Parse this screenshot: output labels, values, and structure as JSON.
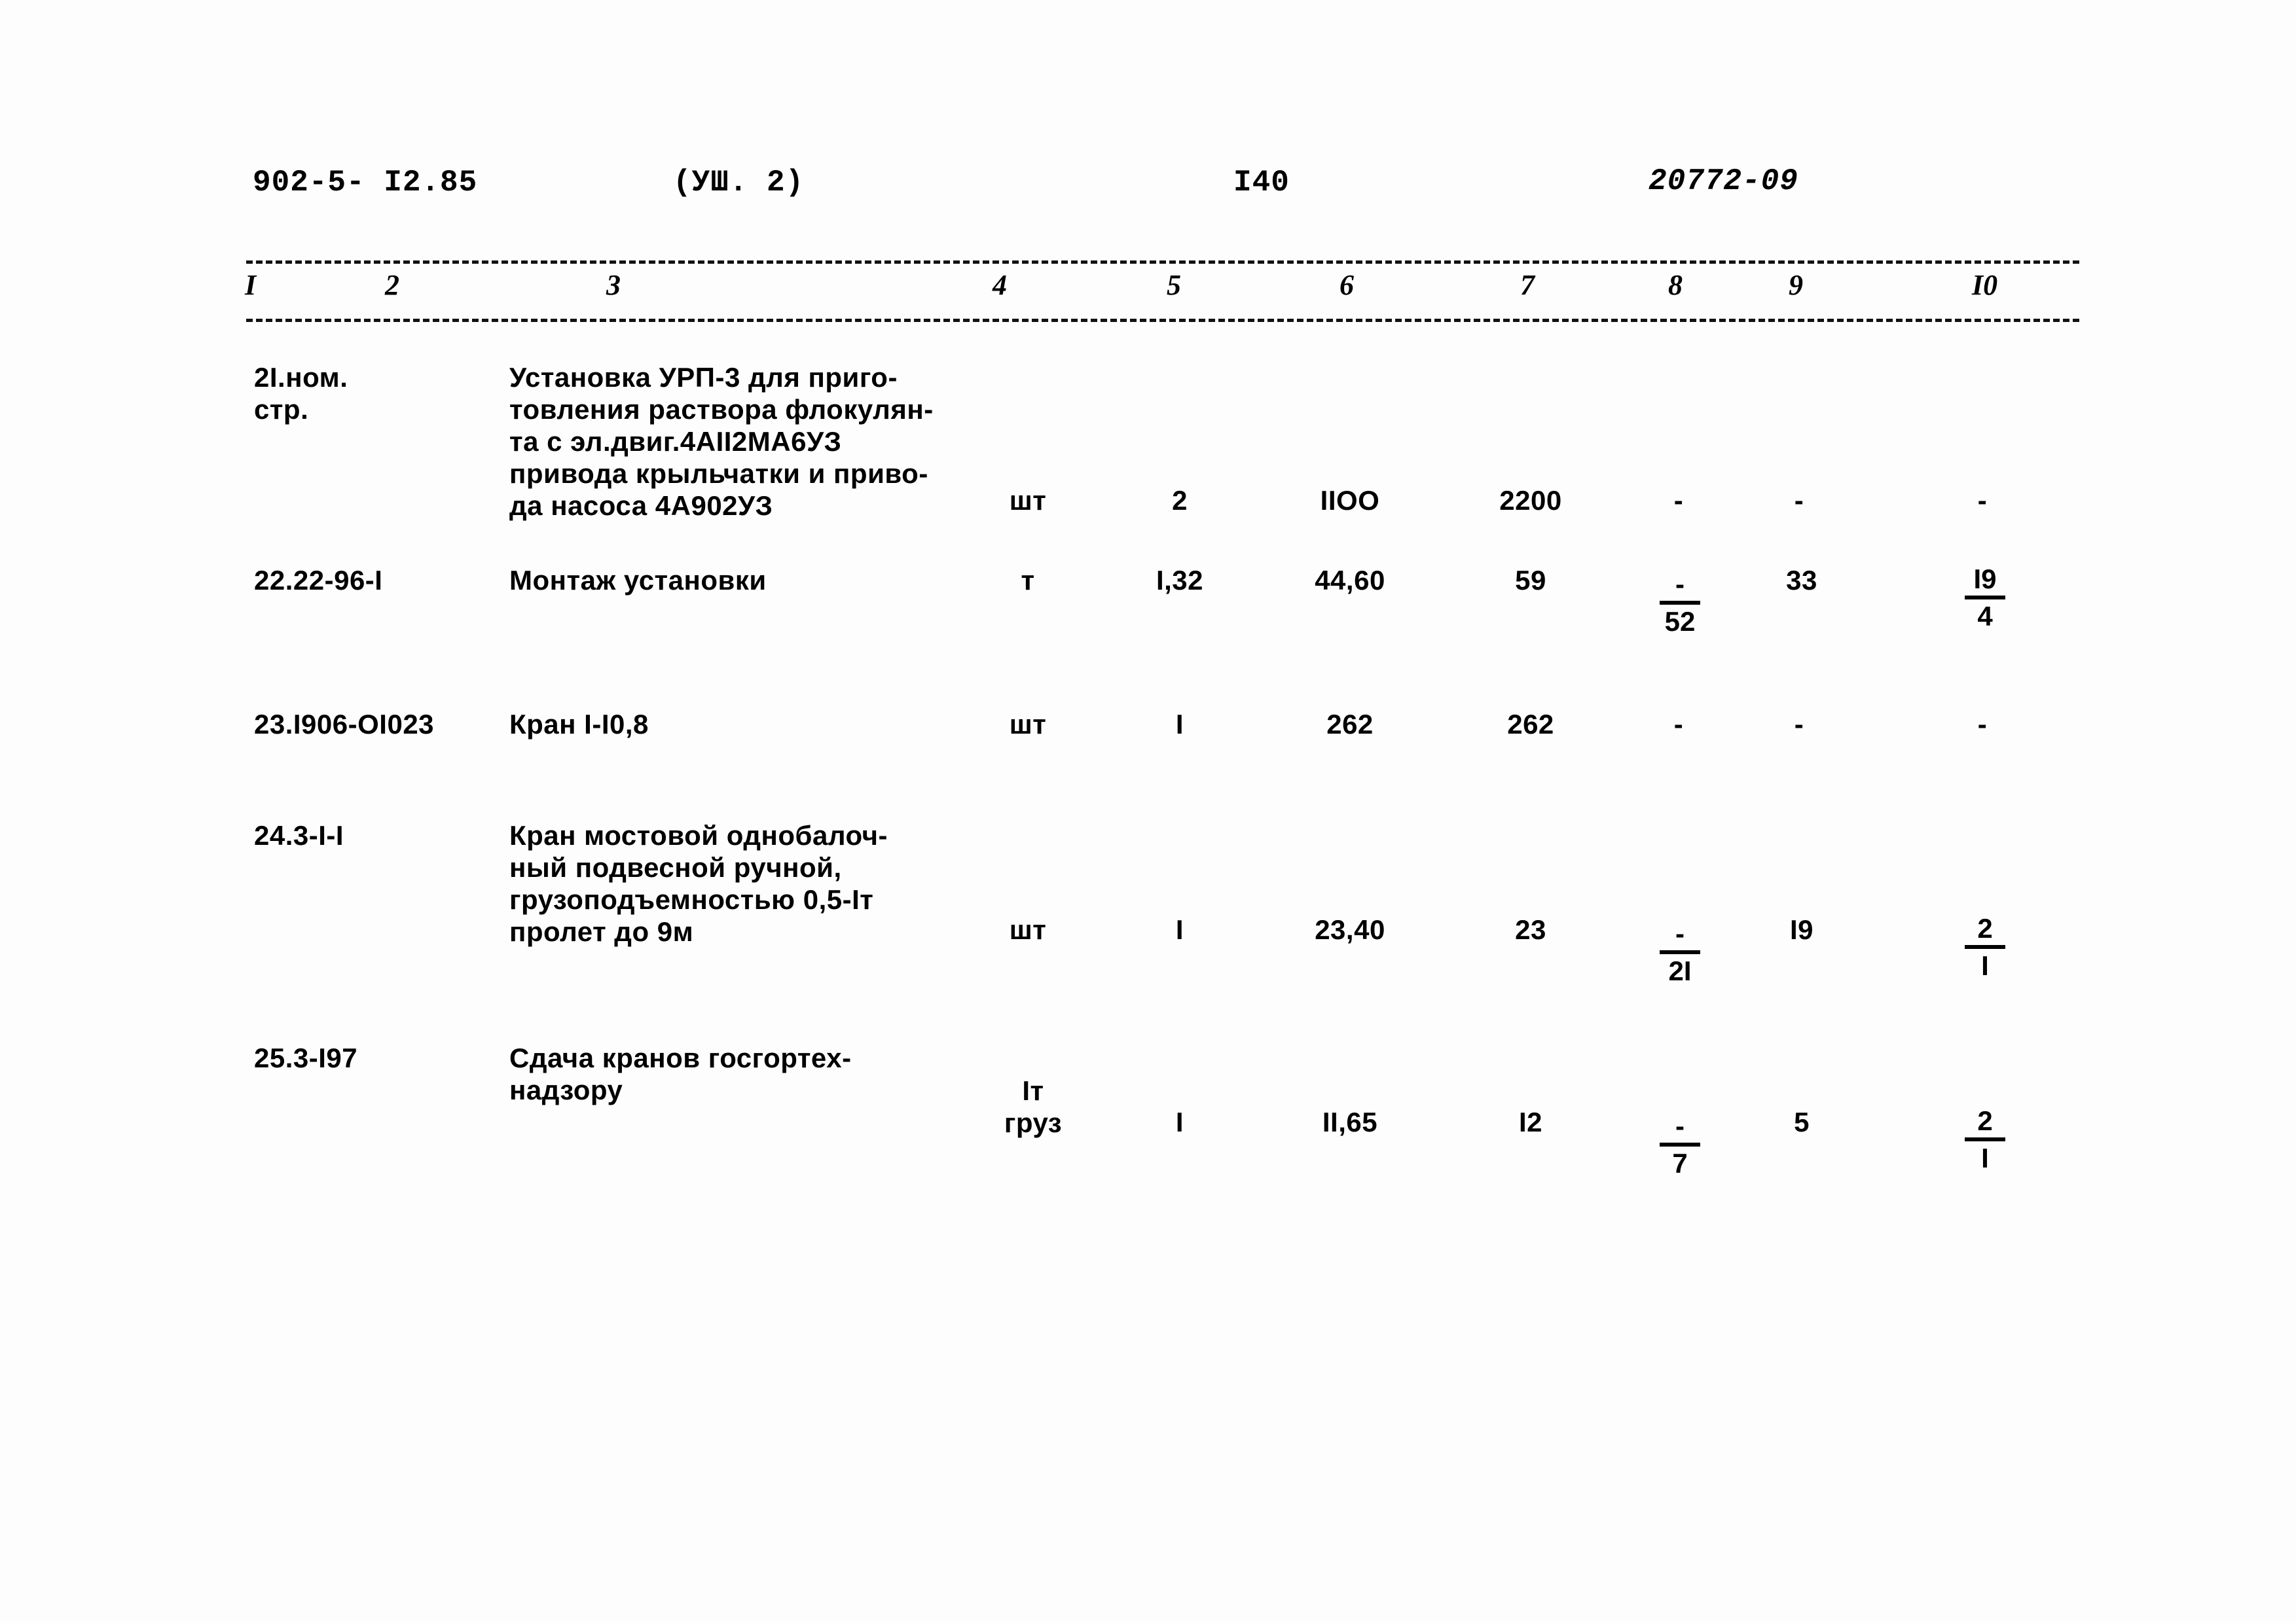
{
  "header": {
    "doc_code": "902-5- I2.85",
    "section": "(УШ. 2)",
    "page_number": "I40",
    "right_code": "20772-09"
  },
  "table": {
    "column_headers": [
      "I",
      "2",
      "3",
      "4",
      "5",
      "6",
      "7",
      "8",
      "9",
      "I0"
    ],
    "rows": [
      {
        "c1": "2I.ном.\n  стр.",
        "c3": "Установка УРП-3 для приго-\nтовления раствора флокулян-\nта с эл.двиг.4АII2МА6УЗ\nпривода крыльчатки и приво-\nда насоса 4А902УЗ",
        "c4": "шт",
        "c5": "2",
        "c6": "IIOO",
        "c7": "2200",
        "c8": "-",
        "c9": "-",
        "c10": "-"
      },
      {
        "c1": "22.22-96-I",
        "c3": "Монтаж установки",
        "c4": "т",
        "c5": "I,32",
        "c6": "44,60",
        "c7": "59",
        "c8_num": "-",
        "c8_den": "52",
        "c9": "33",
        "c10_num": "I9",
        "c10_den": "4"
      },
      {
        "c1": "23.I906-OI023",
        "c3": "Кран I-I0,8",
        "c4": "шт",
        "c5": "I",
        "c6": "262",
        "c7": "262",
        "c8": "-",
        "c9": "-",
        "c10": "-"
      },
      {
        "c1": "24.3-I-I",
        "c3": "Кран мостовой однобалоч-\nный подвесной ручной,\nгрузоподъемностью 0,5-Iт\nпролет до 9м",
        "c4": "шт",
        "c5": "I",
        "c6": "23,40",
        "c7": "23",
        "c8_num": "-",
        "c8_den": "2I",
        "c9": "I9",
        "c10_num": "2",
        "c10_den": "I"
      },
      {
        "c1": "25.3-I97",
        "c3": "Сдача кранов госгортех-\nнадзору",
        "c4": "Iт\nгруз",
        "c5": "I",
        "c6": "II,65",
        "c7": "I2",
        "c8_num": "-",
        "c8_den": "7",
        "c9": "5",
        "c10_num": "2",
        "c10_den": "I"
      }
    ]
  }
}
